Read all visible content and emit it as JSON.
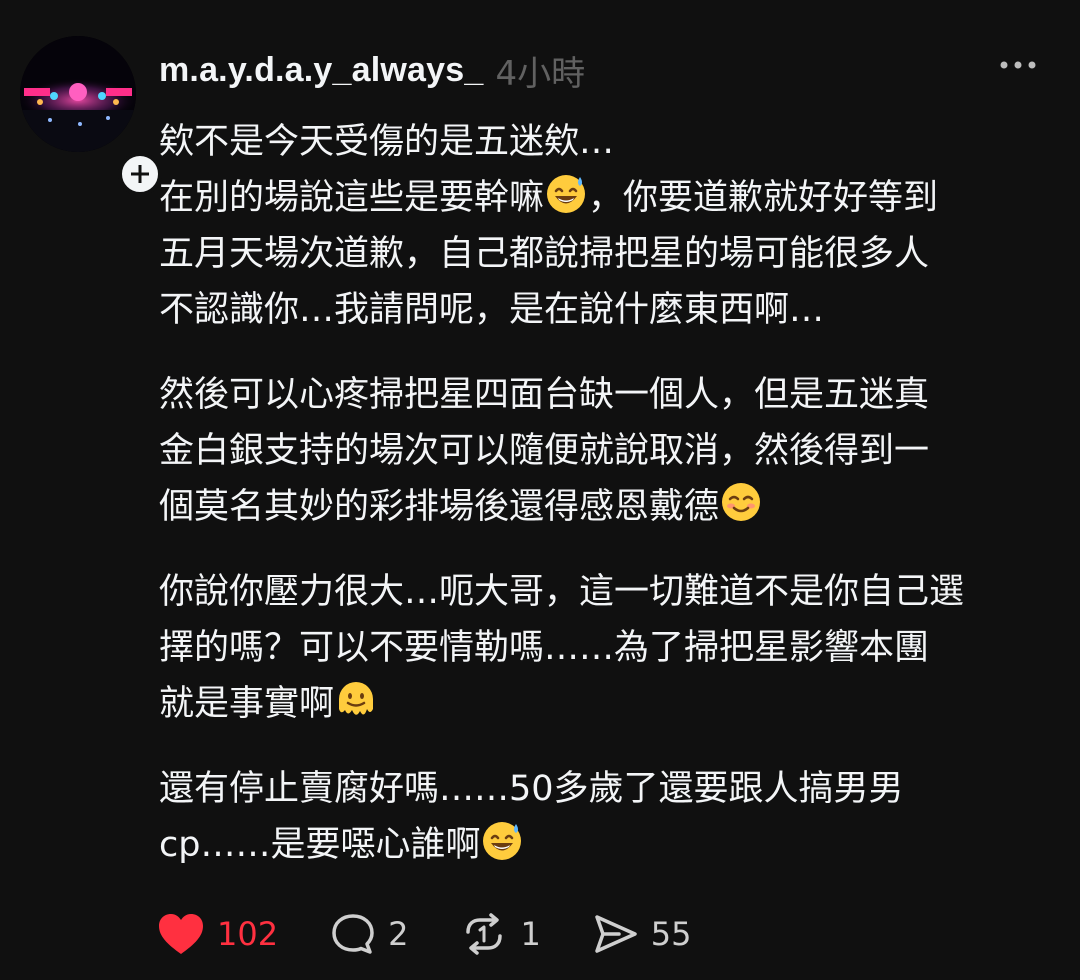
{
  "post": {
    "username": "m.a.y.d.a.y_always_",
    "timestamp": "4小時",
    "paragraphs": [
      {
        "lines": [
          {
            "text": "欸不是今天受傷的是五迷欸…"
          },
          {
            "text": "在別的場說這些是要幹嘛",
            "emoji": "sweat-smile-emoji",
            "after": "，你要道歉就好好等到"
          },
          {
            "text": "五月天場次道歉，自己都說掃把星的場可能很多人"
          },
          {
            "text": "不認識你…我請問呢，是在說什麼東西啊…"
          }
        ]
      },
      {
        "lines": [
          {
            "text": "然後可以心疼掃把星四面台缺一個人，但是五迷真"
          },
          {
            "text": "金白銀支持的場次可以隨便就說取消，然後得到一"
          },
          {
            "text": "個莫名其妙的彩排場後還得感恩戴德",
            "emoji": "smiling-blush-emoji",
            "after": ""
          }
        ]
      },
      {
        "lines": [
          {
            "text": "你說你壓力很大…呃大哥，這一切難道不是你自己選"
          },
          {
            "text": "擇的嗎？可以不要情勒嗎……為了掃把星影響本團"
          },
          {
            "text": "就是事實啊",
            "emoji": "melting-face-emoji",
            "after": ""
          }
        ]
      },
      {
        "lines": [
          {
            "text": "還有停止賣腐好嗎……50多歲了還要跟人搞男男"
          },
          {
            "text": "cp……是要噁心誰啊",
            "emoji": "sweat-smile-emoji",
            "after": ""
          }
        ]
      }
    ]
  },
  "actions": {
    "like_count": "102",
    "comment_count": "2",
    "repost_count": "1",
    "share_count": "55"
  },
  "colors": {
    "background": "#101010",
    "text": "#f3f5f7",
    "muted": "#616161",
    "like": "#ff3040"
  }
}
